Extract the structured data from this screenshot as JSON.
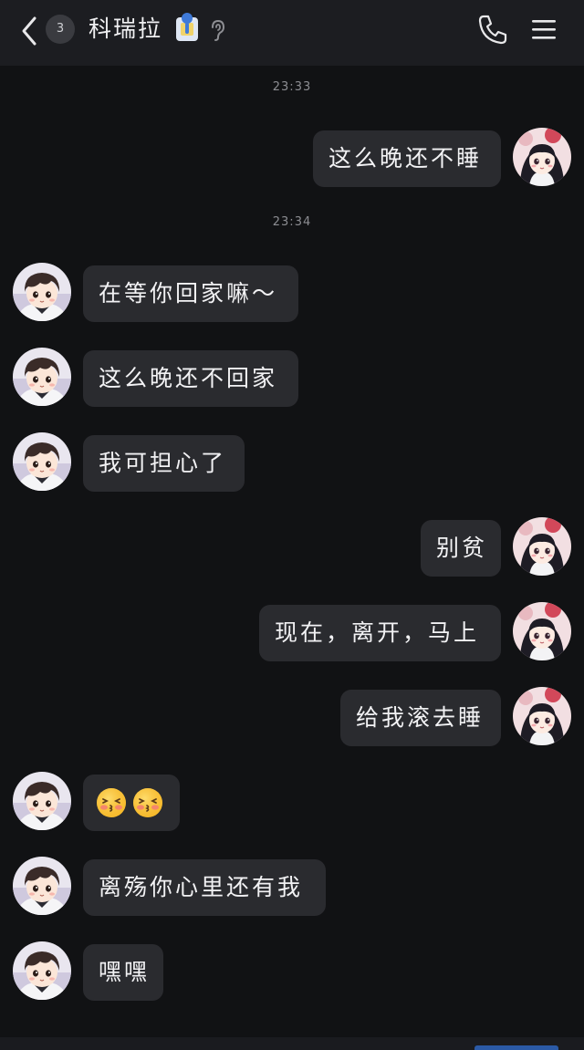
{
  "header": {
    "unread_badge": "3",
    "title": "科瑞拉",
    "icons": [
      "back-arrow-icon",
      "vip-badge-icon",
      "ear-icon",
      "phone-icon",
      "menu-icon"
    ]
  },
  "messages": [
    {
      "type": "timestamp",
      "text": "23:33"
    },
    {
      "type": "message",
      "side": "right",
      "text": "这么晚还不睡"
    },
    {
      "type": "timestamp",
      "text": "23:34"
    },
    {
      "type": "message",
      "side": "left",
      "text": "在等你回家嘛～"
    },
    {
      "type": "message",
      "side": "left",
      "text": "这么晚还不回家"
    },
    {
      "type": "message",
      "side": "left",
      "text": "我可担心了"
    },
    {
      "type": "message",
      "side": "right",
      "text": "别贫"
    },
    {
      "type": "message",
      "side": "right",
      "text": "现在，离开，马上"
    },
    {
      "type": "message",
      "side": "right",
      "text": "给我滚去睡"
    },
    {
      "type": "message",
      "side": "left",
      "content": "emoji",
      "emoji": [
        "blushing-kiss-emoji",
        "blushing-kiss-emoji"
      ]
    },
    {
      "type": "message",
      "side": "left",
      "text": "离殇你心里还有我"
    },
    {
      "type": "message",
      "side": "left",
      "text": "嘿嘿"
    }
  ],
  "colors": {
    "background": "#111214",
    "header": "#1c1d21",
    "bubble": "#2a2b2f",
    "text": "#f2f2f4",
    "timestamp": "#8c8d92"
  }
}
